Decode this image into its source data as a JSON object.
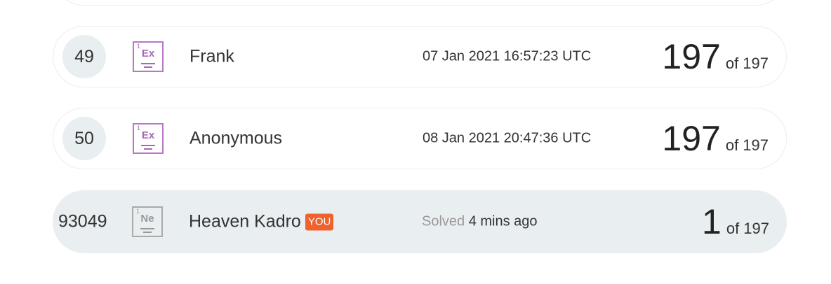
{
  "leaderboard": {
    "rows": [
      {
        "rank": "49",
        "badge": {
          "symbol": "Ex",
          "number": "1"
        },
        "name": "Frank",
        "timestamp": "07 Jan 2021 16:57:23 UTC",
        "score": "197",
        "total": "of 197"
      },
      {
        "rank": "50",
        "badge": {
          "symbol": "Ex",
          "number": "1"
        },
        "name": "Anonymous",
        "timestamp": "08 Jan 2021 20:47:36 UTC",
        "score": "197",
        "total": "of 197"
      }
    ],
    "you_row": {
      "rank": "93049",
      "badge": {
        "symbol": "Ne",
        "number": "1"
      },
      "name": "Heaven Kadro",
      "you_tag": "YOU",
      "solved_label": "Solved",
      "solved_time": "4 mins ago",
      "score": "1",
      "total": "of 197"
    }
  },
  "colors": {
    "ex_badge": "#b777c7",
    "ne_badge": "#aaaaaa",
    "you_tag_bg": "#f0622d",
    "you_row_bg": "#e9eef0",
    "rank_circle_bg": "#e9eef0"
  }
}
